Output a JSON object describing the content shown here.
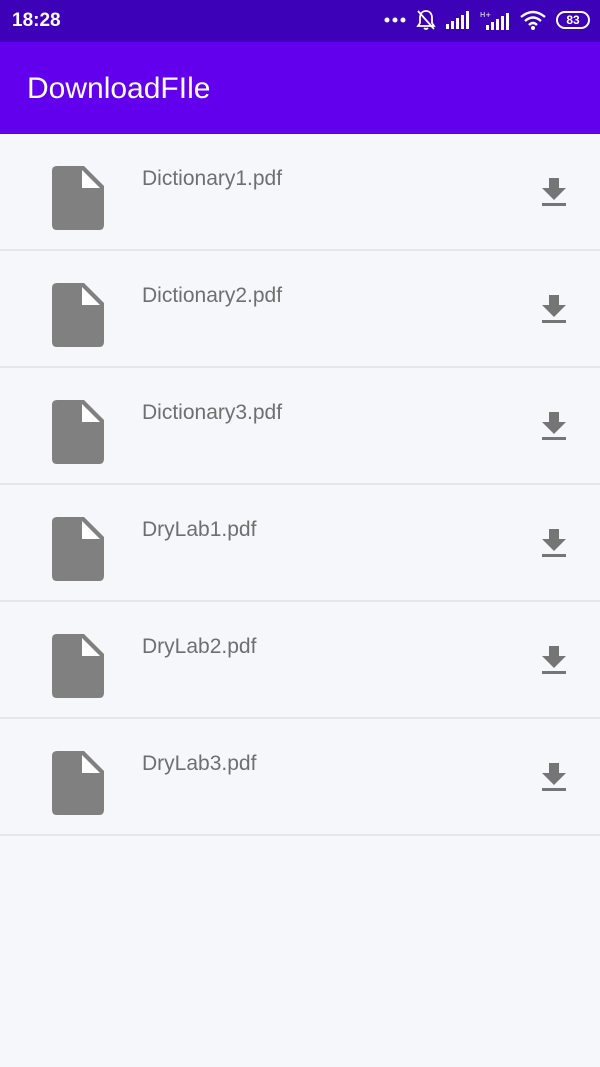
{
  "status_bar": {
    "time": "18:28",
    "battery": "83",
    "icons": [
      "more-dots-icon",
      "bell-off-icon",
      "signal-icon",
      "hplus-signal-icon",
      "wifi-icon",
      "battery-icon"
    ]
  },
  "app_bar": {
    "title": "DownloadFIle",
    "color": "#6200ee"
  },
  "files": [
    {
      "name": "Dictionary1.pdf",
      "icon": "file-icon",
      "action_icon": "download-icon"
    },
    {
      "name": "Dictionary2.pdf",
      "icon": "file-icon",
      "action_icon": "download-icon"
    },
    {
      "name": "Dictionary3.pdf",
      "icon": "file-icon",
      "action_icon": "download-icon"
    },
    {
      "name": "DryLab1.pdf",
      "icon": "file-icon",
      "action_icon": "download-icon"
    },
    {
      "name": "DryLab2.pdf",
      "icon": "file-icon",
      "action_icon": "download-icon"
    },
    {
      "name": "DryLab3.pdf",
      "icon": "file-icon",
      "action_icon": "download-icon"
    }
  ]
}
